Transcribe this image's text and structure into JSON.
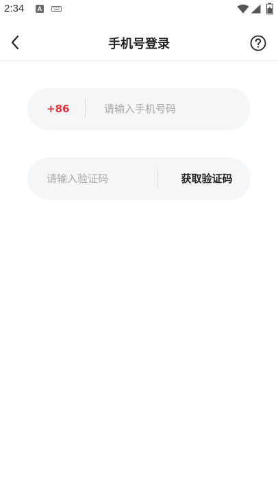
{
  "status_bar": {
    "time": "2:34",
    "notification_letter": "A"
  },
  "header": {
    "title": "手机号登录",
    "back_icon": "chevron-left-icon",
    "help_icon": "question-circle-icon"
  },
  "phone_field": {
    "country_code": "+86",
    "placeholder": "请输入手机号码",
    "value": ""
  },
  "code_field": {
    "placeholder": "请输入验证码",
    "value": "",
    "get_code_label": "获取验证码"
  },
  "colors": {
    "accent": "#e2333d",
    "field_bg": "#f5f6f8",
    "placeholder": "#a8a8a8",
    "text": "#222222"
  }
}
